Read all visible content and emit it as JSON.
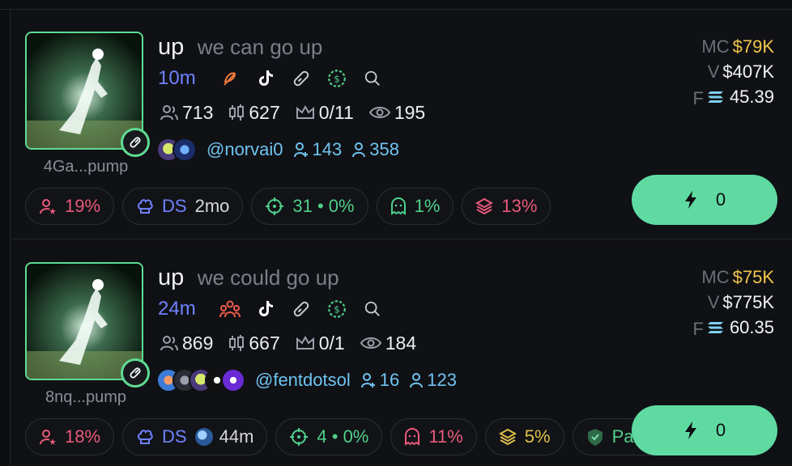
{
  "colors": {
    "accent_green": "#5fdba2",
    "mc_yellow": "#f3c64b",
    "age_blue": "#6f82ff",
    "handle_blue": "#6fc3f0",
    "danger_red": "#e85a7a"
  },
  "tokens": [
    {
      "ticker": "up",
      "name": "we can go up",
      "age": "10m",
      "address": "4Ga...pump",
      "holders": "713",
      "txns": "627",
      "crown": "0/11",
      "views": "195",
      "handle": "@norvai0",
      "followers": "143",
      "following": "358",
      "mc_label": "MC",
      "mc": "$79K",
      "v_label": "V",
      "volume": "$407K",
      "f_label": "F",
      "fee": "45.39",
      "chips": {
        "top_holders": "19%",
        "ds_label": "DS",
        "ds_age": "2mo",
        "snipers": "31 • 0%",
        "insiders": "1%",
        "bundles": "13%"
      },
      "buy_amount": "0"
    },
    {
      "ticker": "up",
      "name": "we could go up",
      "age": "24m",
      "address": "8nq...pump",
      "holders": "869",
      "txns": "667",
      "crown": "0/1",
      "views": "184",
      "handle": "@fentdotsol",
      "followers": "16",
      "following": "123",
      "mc_label": "MC",
      "mc": "$75K",
      "v_label": "V",
      "volume": "$775K",
      "f_label": "F",
      "fee": "60.35",
      "chips": {
        "top_holders": "18%",
        "ds_label": "DS",
        "ds_age": "44m",
        "snipers": "4 • 0%",
        "insiders": "11%",
        "bundles": "5%",
        "partial": "Pa"
      },
      "buy_amount": "0"
    }
  ],
  "icons": [
    "pill-icon",
    "feather-icon",
    "tiktok-icon",
    "search-icon",
    "users-icon",
    "candles-icon",
    "crown-icon",
    "eye-icon",
    "lightning-icon",
    "solana-icon",
    "crosshair-icon",
    "ghost-icon",
    "layers-icon",
    "chef-hat-icon",
    "user-star-icon",
    "dex-icon"
  ]
}
